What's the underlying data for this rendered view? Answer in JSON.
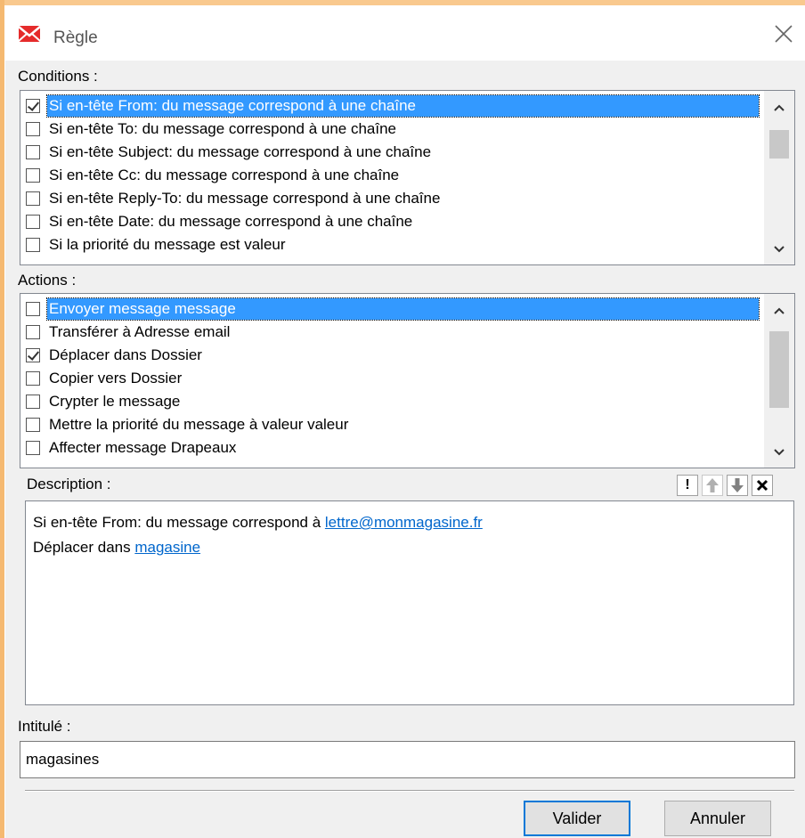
{
  "window": {
    "title": "Règle"
  },
  "conditions": {
    "label": "Conditions :",
    "items": [
      {
        "text": "Si en-tête From: du message correspond à une chaîne",
        "checked": true,
        "selected": true
      },
      {
        "text": "Si en-tête To: du message correspond à une chaîne",
        "checked": false,
        "selected": false
      },
      {
        "text": "Si en-tête Subject: du message correspond à une chaîne",
        "checked": false,
        "selected": false
      },
      {
        "text": "Si en-tête Cc: du message correspond à une chaîne",
        "checked": false,
        "selected": false
      },
      {
        "text": "Si en-tête Reply-To: du message correspond à une chaîne",
        "checked": false,
        "selected": false
      },
      {
        "text": "Si en-tête Date: du message correspond à une chaîne",
        "checked": false,
        "selected": false
      },
      {
        "text": "Si la priorité du message est valeur",
        "checked": false,
        "selected": false
      }
    ]
  },
  "actions": {
    "label": "Actions :",
    "items": [
      {
        "text": "Envoyer message message",
        "checked": false,
        "selected": true
      },
      {
        "text": "Transférer à Adresse email",
        "checked": false,
        "selected": false
      },
      {
        "text": "Déplacer dans Dossier",
        "checked": true,
        "selected": false
      },
      {
        "text": "Copier vers Dossier",
        "checked": false,
        "selected": false
      },
      {
        "text": "Crypter le message",
        "checked": false,
        "selected": false
      },
      {
        "text": "Mettre la priorité du message à valeur valeur",
        "checked": false,
        "selected": false
      },
      {
        "text": "Affecter message Drapeaux",
        "checked": false,
        "selected": false
      }
    ]
  },
  "description": {
    "label": "Description :",
    "line1_prefix": "Si en-tête From: du message correspond à ",
    "line1_link": "lettre@monmagasine.fr",
    "line2_prefix": "Déplacer dans ",
    "line2_link": "magasine"
  },
  "toolbar": {
    "important": "!",
    "up": "🡅",
    "down": "🡇",
    "delete": "✕"
  },
  "name_field": {
    "label": "Intitulé :",
    "value": "magasines"
  },
  "buttons": {
    "ok": "Valider",
    "cancel": "Annuler"
  },
  "colors": {
    "selection": "#3399ff",
    "link": "#0066cc",
    "default_button_border": "#0078d7"
  }
}
